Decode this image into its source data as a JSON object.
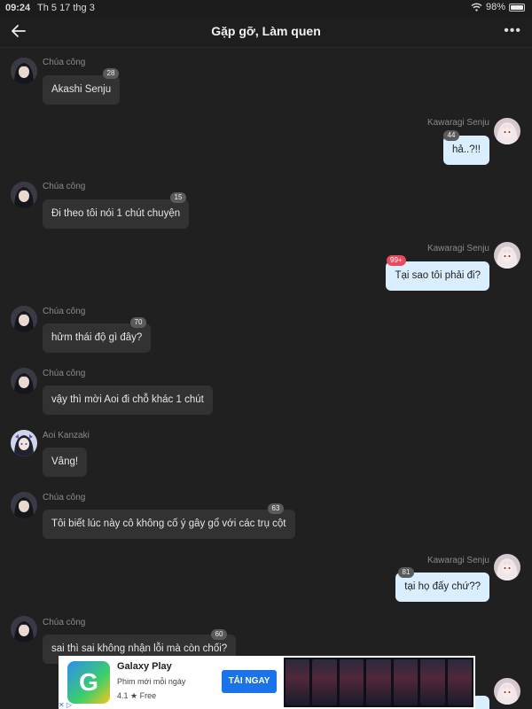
{
  "status": {
    "time": "09:24",
    "date": "Th 5 17 thg 3",
    "battery": "98%"
  },
  "header": {
    "title": "Gặp gỡ, Làm quen"
  },
  "messages": [
    {
      "side": "left",
      "sender": "Chúa công",
      "text": "Akashi Senju",
      "badge": "28"
    },
    {
      "side": "right",
      "sender": "Kawaragi Senju",
      "text": "hả..?!!",
      "badge": "44"
    },
    {
      "side": "left",
      "sender": "Chúa công",
      "text": "Đi theo tôi nói 1 chút chuyện",
      "badge": "15"
    },
    {
      "side": "right",
      "sender": "Kawaragi Senju",
      "text": "Tại sao tôi phải đi?",
      "badge": "99+"
    },
    {
      "side": "left",
      "sender": "Chúa công",
      "text": "hửm thái độ gì đây?",
      "badge": "70"
    },
    {
      "side": "left",
      "sender": "Chúa công",
      "text": "vậy thì mời Aoi đi chỗ khác 1 chút",
      "badge": ""
    },
    {
      "side": "left",
      "sender": "Aoi Kanzaki",
      "text": "Vâng!",
      "badge": ""
    },
    {
      "side": "left",
      "sender": "Chúa công",
      "text": "Tôi biết lúc này cô không cố ý gây gổ với các trụ cột",
      "badge": "63"
    },
    {
      "side": "right",
      "sender": "Kawaragi Senju",
      "text": "tại họ đấy chứ??",
      "badge": "81"
    },
    {
      "side": "left",
      "sender": "Chúa công",
      "text": "sai thì sai không nhận lỗi mà còn chối?",
      "badge": "60"
    },
    {
      "side": "right",
      "sender": "Kawaragi Senju",
      "text": "",
      "badge": ""
    }
  ],
  "ad": {
    "app_name": "Galaxy Play",
    "subtitle": "Phim mới mỗi ngày",
    "rating": "4.1 ★  Free",
    "cta": "TẢI NGAY",
    "logo_letter": "G"
  },
  "colors": {
    "background": "#202020",
    "bubble_left": "#323232",
    "bubble_right": "#d9efff",
    "badge_red": "#e84a5f"
  }
}
